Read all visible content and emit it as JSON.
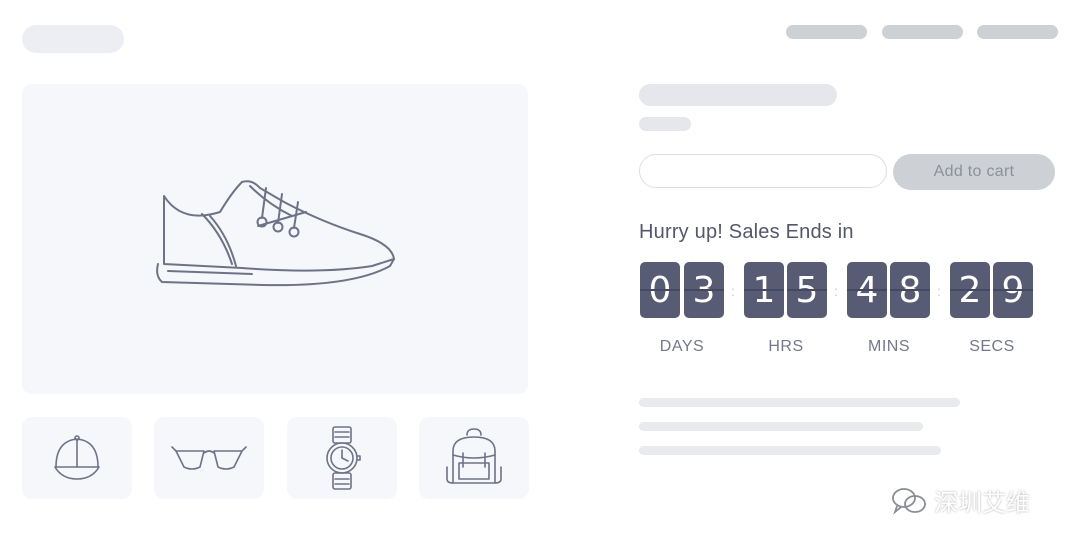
{
  "icons": {
    "hero": "sneaker-icon",
    "thumbnails": [
      "cap-icon",
      "sunglasses-icon",
      "wristwatch-icon",
      "backpack-icon"
    ],
    "watermark": "wechat-icon"
  },
  "cart": {
    "button_label": "Add to cart",
    "quantity_value": ""
  },
  "countdown": {
    "heading": "Hurry up! Sales Ends in",
    "units": [
      {
        "digits": [
          "0",
          "3"
        ],
        "label": "DAYS"
      },
      {
        "digits": [
          "1",
          "5"
        ],
        "label": "HRS"
      },
      {
        "digits": [
          "4",
          "8"
        ],
        "label": "MINS"
      },
      {
        "digits": [
          "2",
          "9"
        ],
        "label": "SECS"
      }
    ],
    "separator": ":"
  },
  "watermark": {
    "text": "深圳艾维"
  },
  "colors": {
    "digit_bg": "#575b73",
    "placeholder": "#cdd0d5",
    "panel_bg": "#f6f7fb",
    "icon_stroke": "#6e7286"
  }
}
